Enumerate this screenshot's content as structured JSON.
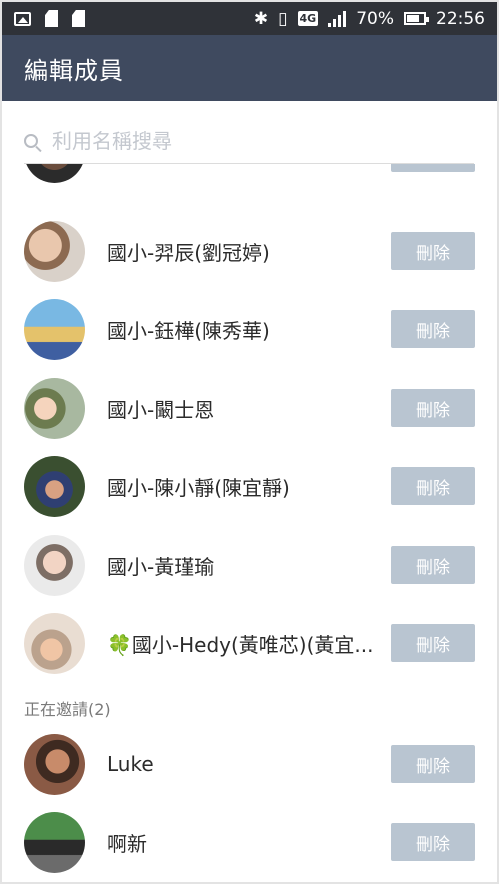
{
  "status_bar": {
    "left_icons": [
      "image-icon",
      "sd-card-icon",
      "sd-card-icon"
    ],
    "network": "4G",
    "battery": "70%",
    "time": "22:56"
  },
  "app_bar": {
    "title": "編輯成員"
  },
  "search": {
    "placeholder": "利用名稱搜尋"
  },
  "members": [
    {
      "name": "國小-羿辰(劉冠婷)",
      "delete": "刪除"
    },
    {
      "name": "國小-鈺樺(陳秀華)",
      "delete": "刪除"
    },
    {
      "name": "國小-闞士恩",
      "delete": "刪除"
    },
    {
      "name": "國小-陳小靜(陳宜靜)",
      "delete": "刪除"
    },
    {
      "name": "國小-黃瑾瑜",
      "delete": "刪除"
    },
    {
      "name": "🍀國小-Hedy(黃唯芯)(黃宜...",
      "delete": "刪除"
    }
  ],
  "inviting": {
    "header": "正在邀請(2)",
    "items": [
      {
        "name": "Luke",
        "delete": "刪除"
      },
      {
        "name": "啊新",
        "delete": "刪除"
      }
    ]
  }
}
